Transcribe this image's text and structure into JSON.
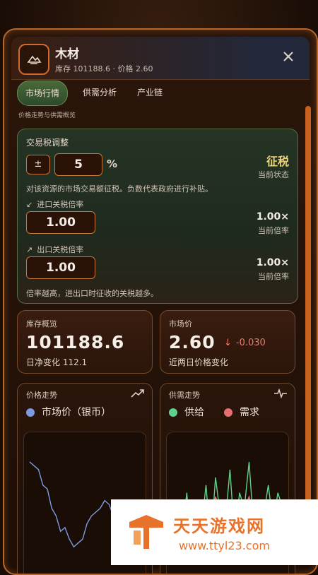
{
  "header": {
    "icon": "wood-icon",
    "title": "木材",
    "subtitle": "库存 101188.6 · 价格 2.60"
  },
  "tabs": [
    {
      "label": "市场行情",
      "active": true
    },
    {
      "label": "供需分析",
      "active": false
    },
    {
      "label": "产业链",
      "active": false
    }
  ],
  "tabs_desc": "价格走势与供需概览",
  "tax": {
    "title": "交易税调整",
    "sign_button": "±",
    "rate_value": "5",
    "rate_unit": "%",
    "status_value": "征税",
    "status_label": "当前状态",
    "description": "对该资源的市场交易额征税。负数代表政府进行补贴。",
    "import_label": "进口关税倍率",
    "import_value": "1.00",
    "import_current": "1.00×",
    "import_current_label": "当前倍率",
    "export_label": "出口关税倍率",
    "export_value": "1.00",
    "export_current": "1.00×",
    "export_current_label": "当前倍率",
    "footer": "倍率越高，进出口时征收的关税越多。"
  },
  "inventory": {
    "label": "库存概览",
    "value": "101188.6",
    "daily_change": "日净变化 112.1"
  },
  "market_price": {
    "label": "市场价",
    "value": "2.60",
    "change": "-0.030",
    "change_label": "近两日价格变化"
  },
  "price_chart": {
    "title": "价格走势",
    "legend": "市场价（银币）",
    "color": "#7e9be0"
  },
  "supply_chart": {
    "title": "供需走势",
    "legend_supply": "供给",
    "legend_demand": "需求",
    "supply_color": "#5fd18c",
    "demand_color": "#e76f6f"
  },
  "watermark": {
    "title": "天天游戏网",
    "url": "www.ttyl23.com"
  },
  "chart_data": [
    {
      "type": "line",
      "title": "",
      "series": [
        {
          "name": "市场价（银币）",
          "values": [
            3.8,
            3.75,
            3.7,
            3.5,
            3.45,
            3.2,
            3.1,
            2.9,
            2.95,
            2.8,
            2.7,
            2.75,
            2.8,
            3.0,
            3.1,
            3.15,
            3.2,
            3.3,
            3.25,
            3.1,
            2.95,
            2.9,
            2.8,
            2.75,
            2.7,
            2.65
          ]
        }
      ]
    },
    {
      "type": "line",
      "title": "",
      "series": [
        {
          "name": "供给",
          "values": [
            120,
            140,
            100,
            160,
            90,
            150,
            110,
            170,
            95,
            180,
            130,
            120,
            190,
            100,
            160,
            140,
            200,
            110,
            150,
            130,
            170,
            120,
            160,
            140
          ]
        },
        {
          "name": "需求",
          "values": [
            130,
            135,
            125,
            145,
            120,
            140,
            130,
            150,
            125,
            155,
            135,
            140,
            150,
            130,
            145,
            140,
            155,
            130,
            150,
            140,
            150,
            135,
            145,
            140
          ]
        }
      ]
    }
  ]
}
